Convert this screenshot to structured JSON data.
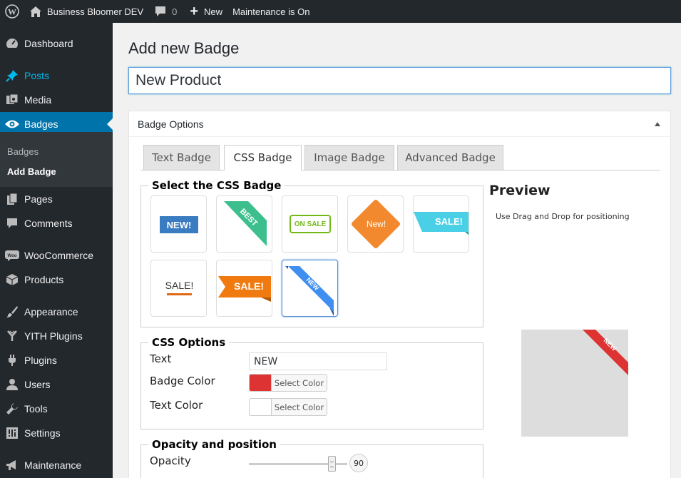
{
  "admin_bar": {
    "site_name": "Business Bloomer DEV",
    "comments_count": "0",
    "new_label": "New",
    "maintenance_label": "Maintenance is On"
  },
  "sidebar": {
    "items": [
      {
        "label": "Dashboard",
        "icon": "dashboard-icon"
      },
      {
        "label": "Posts",
        "icon": "pin-icon"
      },
      {
        "label": "Media",
        "icon": "media-icon"
      },
      {
        "label": "Badges",
        "icon": "eye-icon"
      },
      {
        "label": "Pages",
        "icon": "pages-icon"
      },
      {
        "label": "Comments",
        "icon": "comment-icon"
      },
      {
        "label": "WooCommerce",
        "icon": "woo-icon"
      },
      {
        "label": "Products",
        "icon": "box-icon"
      },
      {
        "label": "Appearance",
        "icon": "brush-icon"
      },
      {
        "label": "YITH Plugins",
        "icon": "yith-icon"
      },
      {
        "label": "Plugins",
        "icon": "plug-icon"
      },
      {
        "label": "Users",
        "icon": "user-icon"
      },
      {
        "label": "Tools",
        "icon": "wrench-icon"
      },
      {
        "label": "Settings",
        "icon": "settings-icon"
      },
      {
        "label": "Maintenance",
        "icon": "megaphone-icon"
      }
    ],
    "submenu": [
      "Badges",
      "Add Badge"
    ]
  },
  "page": {
    "title": "Add new Badge",
    "badge_name_value": "New Product"
  },
  "postbox": {
    "title": "Badge Options",
    "tabs": [
      "Text Badge",
      "CSS Badge",
      "Image Badge",
      "Advanced Badge"
    ],
    "active_tab": "CSS Badge"
  },
  "css_badge": {
    "legend": "Select the CSS Badge",
    "badges": [
      {
        "text": "NEW!",
        "color": "#3a7cc1"
      },
      {
        "text": "BEST",
        "color": "#3dbf8d"
      },
      {
        "text": "ON SALE",
        "color": "#73b816"
      },
      {
        "text": "New!",
        "color": "#f2892e"
      },
      {
        "text": "SALE!",
        "color": "#4ad0e6"
      },
      {
        "text": "SALE!",
        "color": "#e06a12"
      },
      {
        "text": "SALE!",
        "color": "#f07a10"
      },
      {
        "text": "NEW",
        "color": "#3e8ff0"
      }
    ],
    "selected_index": 7
  },
  "css_options": {
    "legend": "CSS Options",
    "text_label": "Text",
    "text_value": "NEW",
    "badge_color_label": "Badge Color",
    "badge_color": "#dd3333",
    "text_color_label": "Text Color",
    "text_color": "#ffffff",
    "select_color_label": "Select Color"
  },
  "opacity": {
    "legend": "Opacity and position",
    "opacity_label": "Opacity",
    "opacity_value": "90"
  },
  "preview": {
    "title": "Preview",
    "hint": "Use Drag and Drop for positioning",
    "badge_text": "NEW",
    "badge_color": "#dd3333"
  }
}
